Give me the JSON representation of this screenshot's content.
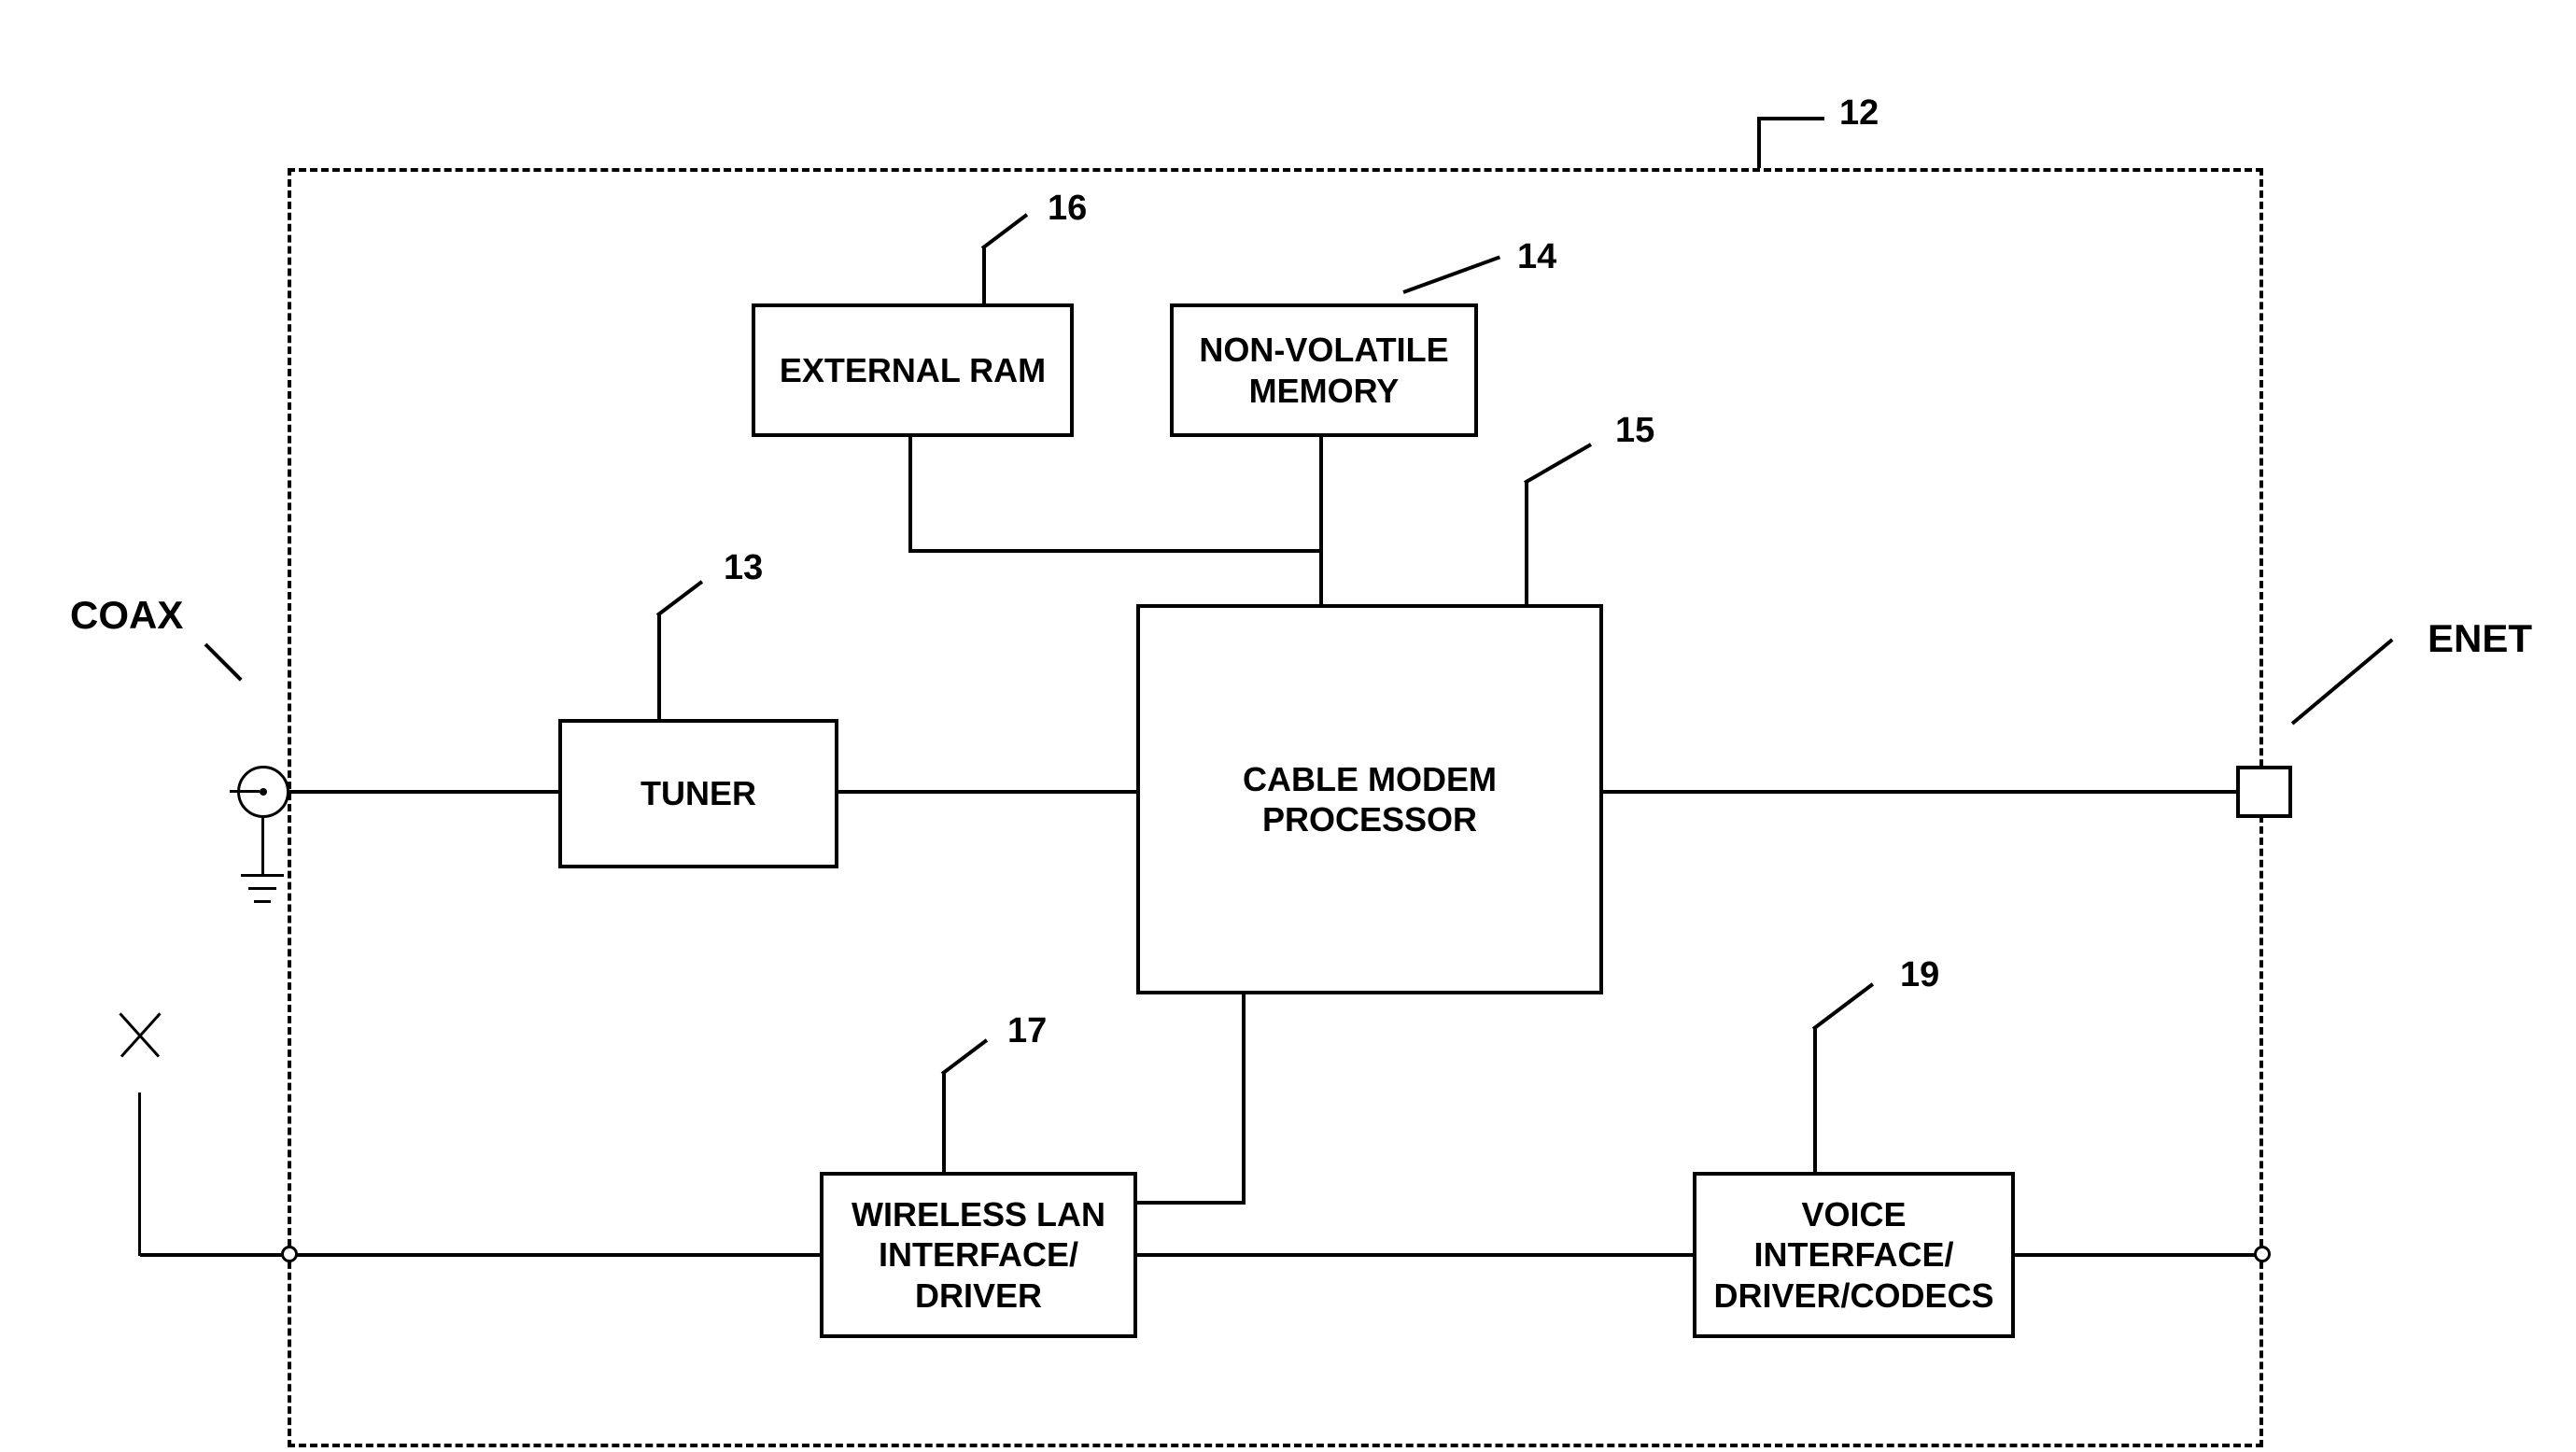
{
  "external_labels": {
    "coax": "COAX",
    "enet": "ENET"
  },
  "refs": {
    "main": "12",
    "tuner": "13",
    "nvm": "14",
    "processor": "15",
    "ram": "16",
    "wlan": "17",
    "voice": "19"
  },
  "blocks": {
    "tuner": "TUNER",
    "ram": "EXTERNAL RAM",
    "nvm": "NON-VOLATILE MEMORY",
    "processor": "CABLE MODEM PROCESSOR",
    "wlan": "WIRELESS LAN INTERFACE/ DRIVER",
    "voice": "VOICE INTERFACE/ DRIVER/CODECS"
  }
}
